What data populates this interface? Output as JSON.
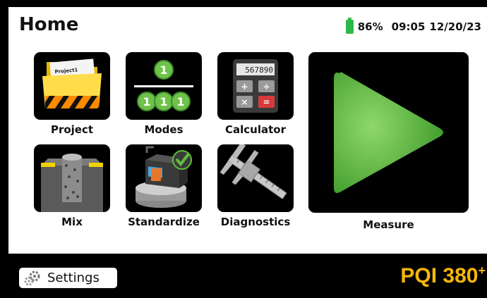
{
  "header": {
    "title": "Home",
    "battery_percent": "86%",
    "time": "09:05",
    "date": "12/20/23",
    "battery_color": "#2db84a"
  },
  "tiles": [
    {
      "label": "Project",
      "icon": "folder-icon",
      "folder_text": "Project1"
    },
    {
      "label": "Modes",
      "icon": "modes-icon",
      "digits": [
        "1",
        "1",
        "1",
        "1"
      ]
    },
    {
      "label": "Calculator",
      "icon": "calculator-icon",
      "display": "567890",
      "keys": [
        "+",
        "÷",
        "×",
        "="
      ]
    },
    {
      "label": "Mix",
      "icon": "asphalt-core-icon"
    },
    {
      "label": "Standardize",
      "icon": "standardize-gauge-icon"
    },
    {
      "label": "Diagnostics",
      "icon": "caliper-icon"
    }
  ],
  "measure": {
    "label": "Measure",
    "icon": "play-icon",
    "color": "#5fbf3a"
  },
  "bottom": {
    "settings_label": "Settings",
    "settings_icon": "gears-icon",
    "brand_name": "PQI 380",
    "brand_sup": "+",
    "brand_color": "#f5b60a"
  }
}
